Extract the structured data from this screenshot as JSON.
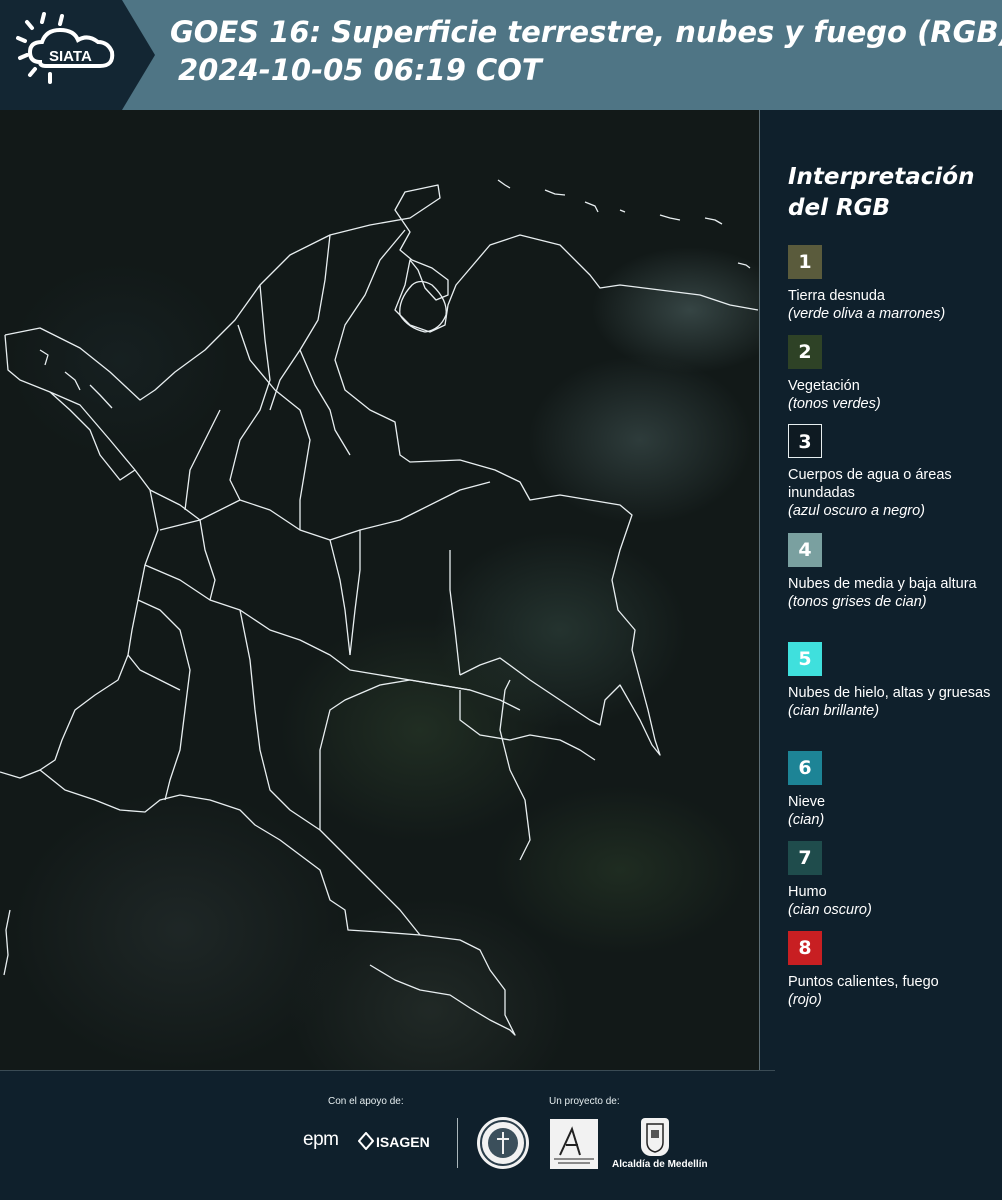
{
  "header": {
    "brand": "SIATA",
    "title_line1": "GOES 16: Superficie terrestre, nubes y fuego (RGB)",
    "title_line2": "2024-10-05 06:19 COT"
  },
  "legend": {
    "title": "Interpretación del RGB",
    "items": [
      {
        "num": "1",
        "label": "Tierra desnuda",
        "desc": "(verde oliva a marrones)",
        "color": "#5a5b3c"
      },
      {
        "num": "2",
        "label": "Vegetación",
        "desc": "(tonos verdes)",
        "color": "#2e4226"
      },
      {
        "num": "3",
        "label": "Cuerpos de agua o áreas inundadas",
        "desc": "(azul oscuro a negro)",
        "color": "#0e1a22"
      },
      {
        "num": "4",
        "label": "Nubes de media y baja altura",
        "desc": "(tonos grises de cian)",
        "color": "#7aa0a0"
      },
      {
        "num": "5",
        "label": "Nubes de hielo, altas y gruesas",
        "desc": "(cian brillante)",
        "color": "#3fe0dd"
      },
      {
        "num": "6",
        "label": "Nieve",
        "desc": "(cian)",
        "color": "#1d8496"
      },
      {
        "num": "7",
        "label": "Humo",
        "desc": "(cian oscuro)",
        "color": "#1f4c4c"
      },
      {
        "num": "8",
        "label": "Puntos calientes, fuego",
        "desc": "(rojo)",
        "color": "#c81f22"
      }
    ]
  },
  "footer": {
    "support_label": "Con el apoyo de:",
    "project_label": "Un proyecto de:",
    "partner1": "epm",
    "partner2": "ISAGEN",
    "partner4": "Alcaldía de Medellín"
  }
}
